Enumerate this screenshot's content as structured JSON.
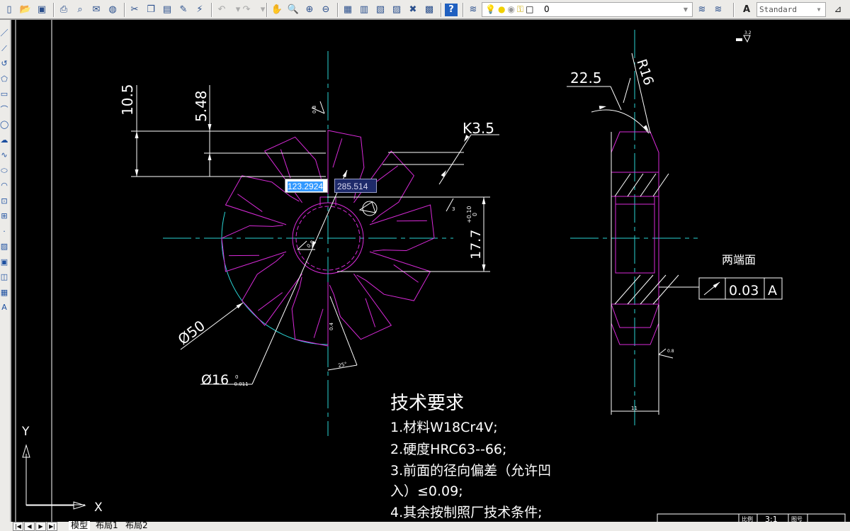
{
  "toolbar": {
    "icons": [
      "new-icon",
      "open-icon",
      "save-icon",
      "sep",
      "print-icon",
      "print-preview-icon",
      "publish-icon",
      "web-icon",
      "sep",
      "cut-icon",
      "copy-icon",
      "paste-icon",
      "match-properties-icon",
      "block-editor-icon",
      "sep",
      "undo-icon",
      "undo-dropdown-icon",
      "redo-icon",
      "redo-dropdown-icon",
      "sep",
      "pan-icon",
      "zoom-realtime-icon",
      "zoom-window-icon",
      "zoom-previous-icon",
      "sep",
      "properties-icon",
      "design-center-icon",
      "tool-palettes-icon",
      "sheet-set-icon",
      "markup-icon",
      "calculator-icon",
      "sep",
      "help-icon",
      "sep",
      "layer-manager-icon"
    ],
    "layer_state_icons": [
      "lightbulb-on-icon",
      "sun-thaw-icon",
      "lock-icon",
      "plot-icon",
      "color-swatch-icon"
    ],
    "layer_value": "0",
    "layer_right_icons": [
      "make-layer-current-icon",
      "layer-previous-icon"
    ],
    "text_style_icon": "text-style-icon",
    "text_style_value": "Standard",
    "dim_style_icon": "dim-style-icon"
  },
  "left_toolbar": {
    "icons": [
      "line-icon",
      "construction-line-icon",
      "polyline-icon",
      "polygon-icon",
      "rectangle-icon",
      "arc-icon",
      "circle-icon",
      "revision-cloud-icon",
      "spline-icon",
      "ellipse-icon",
      "ellipse-arc-icon",
      "insert-block-icon",
      "make-block-icon",
      "point-icon",
      "hatch-icon",
      "gradient-icon",
      "region-icon",
      "table-icon",
      "multiline-text-icon"
    ]
  },
  "canvas": {
    "colors": {
      "geometry": "#d82ad8",
      "centerline": "#2ad4d4",
      "annotation": "#ffffff",
      "background": "#000000"
    },
    "dynamic_input": {
      "x_value": "123.2924",
      "y_value": "285.514"
    },
    "dims": {
      "d10_5": "10.5",
      "d5_48": "5.48",
      "k3_5": "K3.5",
      "d17_7": "17.7",
      "d17_7_tol_upper": "+0.10",
      "d17_7_tol_lower": "0",
      "d50": "Ø50",
      "d16": "Ø16",
      "d16_tol_upper": "0",
      "d16_tol_lower": "-0.011",
      "angle_22_5": "22.5",
      "r16": "R16",
      "width_11": "11",
      "angle_25": "25°",
      "rough_top": "3.2",
      "rough_a": "0.4",
      "rough_b": "3",
      "rough_c": "0.8",
      "rough_d": "0.8",
      "rough_e": "0.8"
    },
    "right_view": {
      "note": "两端面",
      "tolerance_frame": {
        "symbol": "circular-runout-icon",
        "value": "0.03",
        "datum": "A"
      }
    },
    "tech_requirements": {
      "title": "技术要求",
      "lines": [
        "1.材料W18Cr4V;",
        "2.硬度HRC63--66;",
        "3.前面的径向偏差（允许凹",
        "入）≤0.09;",
        "4.其余按制照厂技术条件;"
      ]
    },
    "ucs": {
      "x_label": "X",
      "y_label": "Y"
    },
    "title_block": {
      "scale_label": "比例",
      "scale_value": "3:1",
      "drawing_no_label": "图号"
    }
  },
  "tabs": {
    "nav": [
      "first-tab-icon",
      "prev-tab-icon",
      "next-tab-icon",
      "last-tab-icon"
    ],
    "items": [
      "模型",
      "布局1",
      "布局2"
    ],
    "active": 0
  }
}
